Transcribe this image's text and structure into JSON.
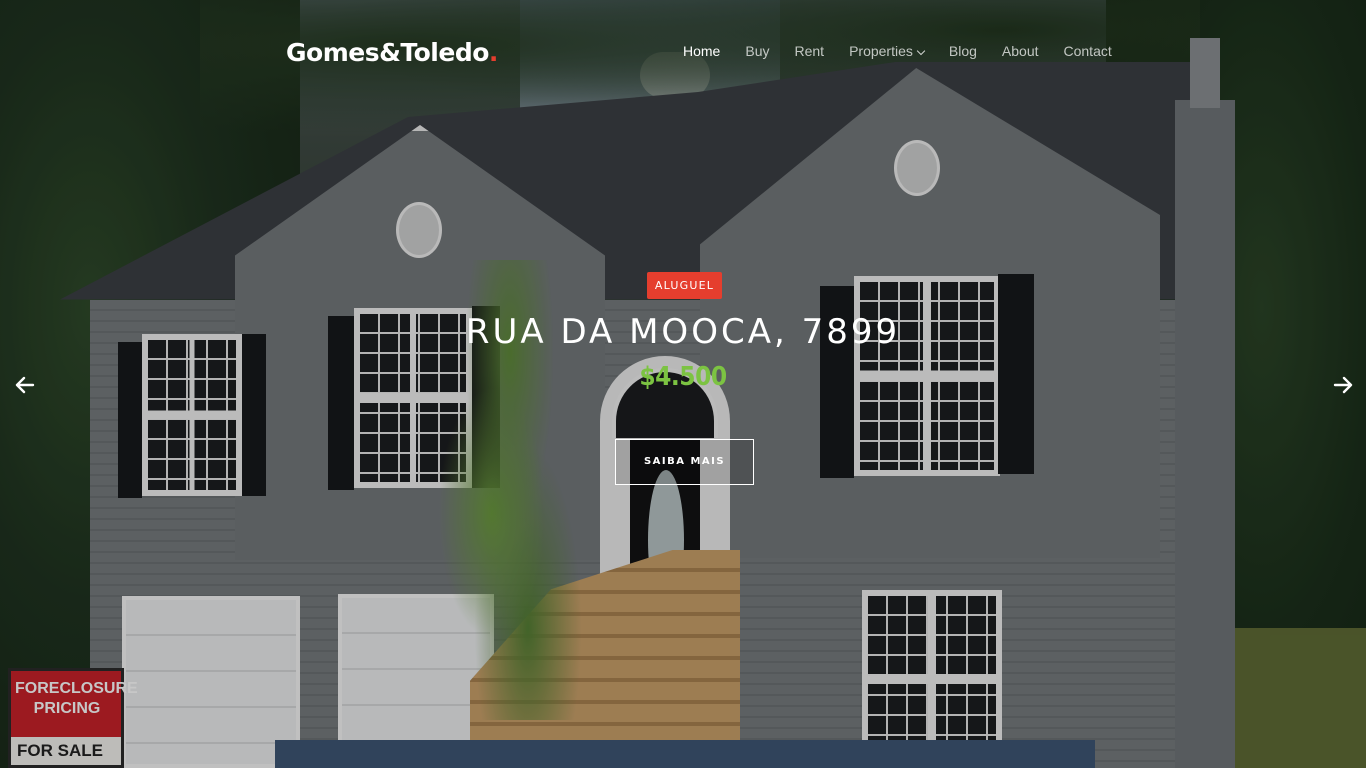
{
  "brand": {
    "name": "Gomes&Toledo",
    "dot": ".",
    "dot_color": "#e53e2e"
  },
  "nav": {
    "items": [
      {
        "label": "Home",
        "active": true
      },
      {
        "label": "Buy",
        "active": false
      },
      {
        "label": "Rent",
        "active": false
      },
      {
        "label": "Properties",
        "active": false,
        "has_dropdown": true
      },
      {
        "label": "Blog",
        "active": false
      },
      {
        "label": "About",
        "active": false
      },
      {
        "label": "Contact",
        "active": false
      }
    ]
  },
  "slide": {
    "badge": "ALUGUEL",
    "badge_color": "#e53e2e",
    "title": "RUA DA MOOCA, 7899",
    "price": "$4.500",
    "price_color": "#7cc342",
    "cta_label": "SAIBA MAIS"
  },
  "background_sign": {
    "line1": "FORECLOSURE",
    "line2": "PRICING",
    "line3": "FOR SALE"
  },
  "icons": {
    "prev": "arrow-left-icon",
    "next": "arrow-right-icon",
    "dropdown": "chevron-down-icon"
  }
}
